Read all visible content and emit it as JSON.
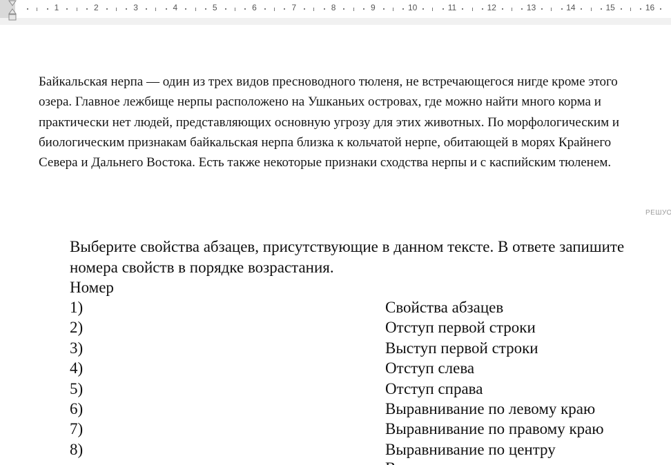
{
  "ruler": {
    "numbers": [
      "1",
      "2",
      "3",
      "4",
      "5",
      "6",
      "7",
      "8",
      "9",
      "10",
      "11",
      "12",
      "13",
      "14",
      "15",
      "16"
    ]
  },
  "paragraph": "Байкальская нерпа — один из трех видов пресноводного тюленя, не встречающегося нигде кроме этого озера. Главное лежбище нерпы расположено на Ушканьих островах, где можно найти много корма и практически нет людей, представляющих основную угрозу для этих животных. По морфологическим и биологическим признакам байкальская нерпа близка к кольчатой нерпе, обитающей в морях Крайнего Севера и Дальнего Востока. Есть также некоторые признаки сходства нерпы и с каспийским тюленем.",
  "side_mark": "РЕШУОГ",
  "question": "Выберите свойства абзацев, присутствующие в данном тексте. В ответе запишите номера свойств в порядке возрастания.",
  "table": {
    "header_left": "Номер",
    "rows": [
      {
        "num": "1)",
        "prop": "Свойства абзацев"
      },
      {
        "num": "2)",
        "prop": "Отступ первой строки"
      },
      {
        "num": "3)",
        "prop": "Выступ первой строки"
      },
      {
        "num": "4)",
        "prop": "Отступ слева"
      },
      {
        "num": "5)",
        "prop": "Отступ справа"
      },
      {
        "num": "6)",
        "prop": "Выравнивание по левому краю"
      },
      {
        "num": "7)",
        "prop": "Выравнивание по правому краю"
      },
      {
        "num": "8)",
        "prop": "Выравнивание по центру"
      }
    ],
    "cut_text": "В"
  }
}
